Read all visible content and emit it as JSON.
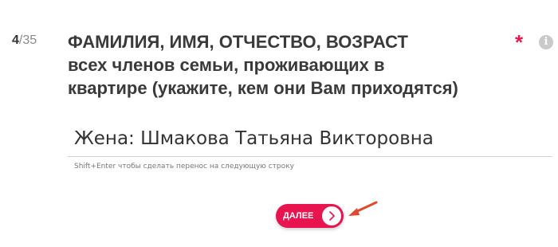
{
  "question": {
    "number": "4",
    "total": "/35",
    "title_line1": "ФАМИЛИЯ, ИМЯ, ОТЧЕСТВО, ВОЗРАСТ",
    "title_line2": "всех членов семьи, проживающих в",
    "title_line3": "квартире (укажите, кем они Вам приходятся)",
    "required_mark": "*",
    "info_glyph": "i"
  },
  "answer": {
    "value": "Жена: Шмакова Татьяна Викторовна",
    "hint": "Shift+Enter чтобы сделать перенос на следующую строку"
  },
  "next_button": {
    "label": "ДАЛЕЕ",
    "icon": "chevron-right-icon"
  },
  "colors": {
    "accent": "#e8144f",
    "annotation_arrow": "#e04a2c"
  }
}
